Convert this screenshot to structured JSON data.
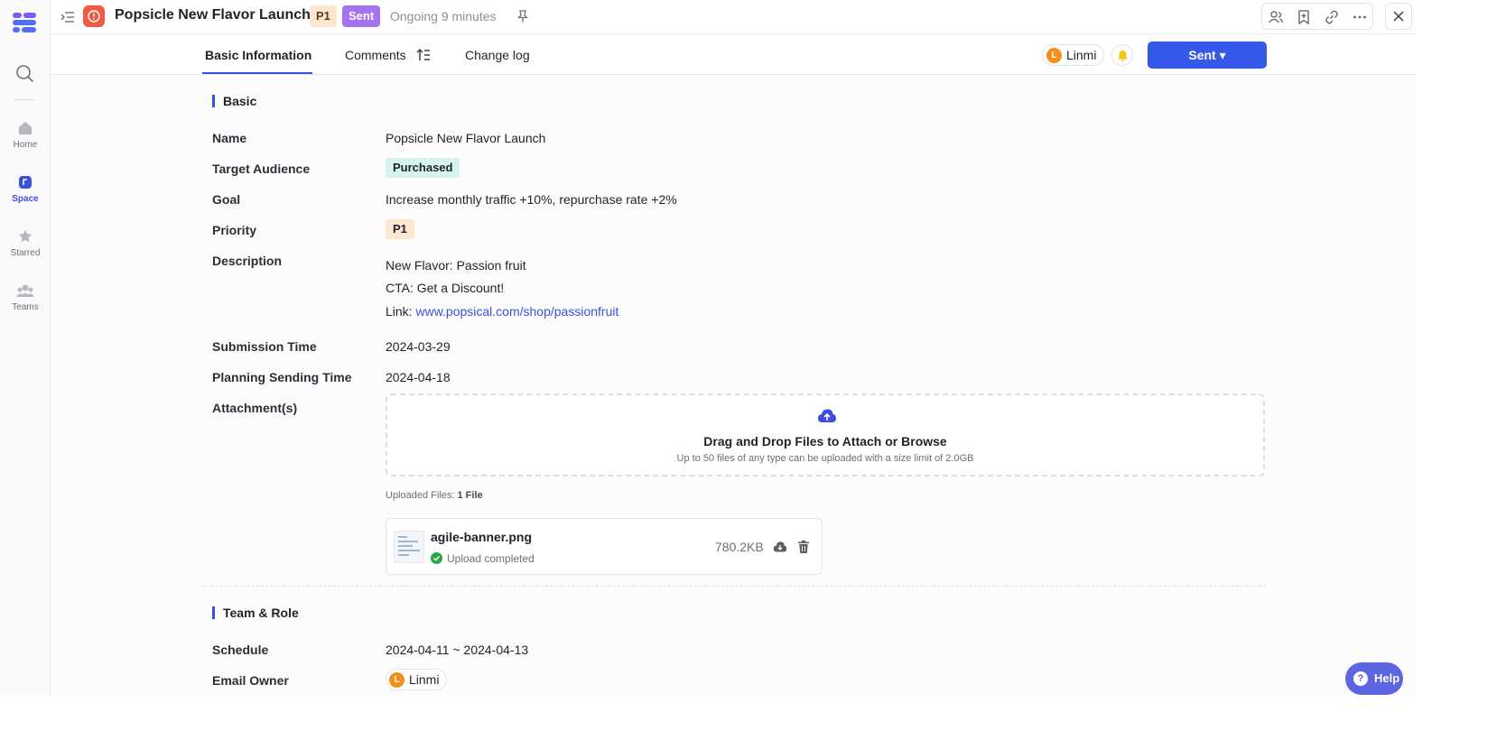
{
  "sidebar": {
    "items": [
      {
        "label": "Home"
      },
      {
        "label": "Space"
      },
      {
        "label": "Starred"
      },
      {
        "label": "Teams"
      }
    ]
  },
  "header": {
    "title": "Popsicle New Flavor Launch",
    "priority_badge": "P1",
    "status_badge": "Sent",
    "ongoing": "Ongoing 9 minutes"
  },
  "tabs": [
    {
      "label": "Basic Information"
    },
    {
      "label": "Comments"
    },
    {
      "label": "Change log"
    }
  ],
  "toolbar": {
    "user_initial": "L",
    "user_name": "Linmi",
    "status_button": "Sent ▾"
  },
  "basic": {
    "section_title": "Basic",
    "name_label": "Name",
    "name_value": "Popsicle New Flavor Launch",
    "audience_label": "Target Audience",
    "audience_value": "Purchased",
    "goal_label": "Goal",
    "goal_value": "Increase monthly traffic +10%, repurchase rate +2%",
    "priority_label": "Priority",
    "priority_value": "P1",
    "description_label": "Description",
    "description_line1": "New Flavor: Passion fruit",
    "description_line2": "CTA: Get a Discount!",
    "description_link_prefix": "Link: ",
    "description_link": "www.popsical.com/shop/passionfruit",
    "submission_label": "Submission Time",
    "submission_value": "2024-03-29",
    "planning_label": "Planning Sending Time",
    "planning_value": "2024-04-18",
    "attachments_label": "Attachment(s)"
  },
  "upload": {
    "title": "Drag and Drop Files to Attach or Browse",
    "subtitle": "Up to 50 files of any type can be uploaded with a size limit of 2.0GB",
    "uploaded_prefix": "Uploaded Files: ",
    "uploaded_count": "1 File",
    "file": {
      "name": "agile-banner.png",
      "status": "Upload completed",
      "size": "780.2KB"
    }
  },
  "team": {
    "section_title": "Team & Role",
    "schedule_label": "Schedule",
    "schedule_value": "2024-04-11 ~ 2024-04-13",
    "owner_label": "Email Owner",
    "owner_initial": "L",
    "owner_name": "Linmi"
  },
  "help_label": "Help",
  "colors": {
    "accent": "#3b50e0",
    "primary_button": "#3558e8",
    "sent_badge": "#a672f0",
    "alert": "#ef5a43",
    "p1_badge": "#fde7d0",
    "audience_tag": "#d6f3ef",
    "avatar": "#f2901c",
    "success": "#27a644"
  }
}
